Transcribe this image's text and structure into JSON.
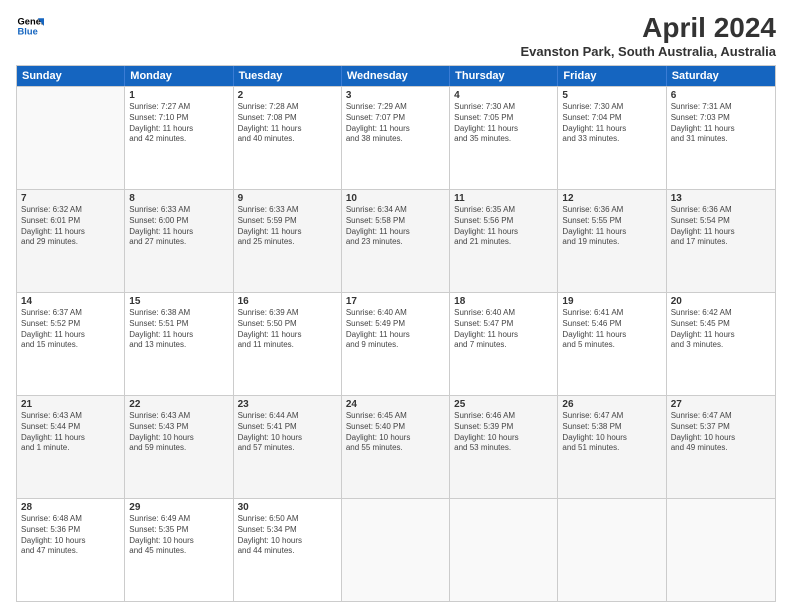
{
  "logo": {
    "line1": "General",
    "line2": "Blue"
  },
  "title": "April 2024",
  "subtitle": "Evanston Park, South Australia, Australia",
  "weekdays": [
    "Sunday",
    "Monday",
    "Tuesday",
    "Wednesday",
    "Thursday",
    "Friday",
    "Saturday"
  ],
  "rows": [
    [
      {
        "day": "",
        "info": ""
      },
      {
        "day": "1",
        "info": "Sunrise: 7:27 AM\nSunset: 7:10 PM\nDaylight: 11 hours\nand 42 minutes."
      },
      {
        "day": "2",
        "info": "Sunrise: 7:28 AM\nSunset: 7:08 PM\nDaylight: 11 hours\nand 40 minutes."
      },
      {
        "day": "3",
        "info": "Sunrise: 7:29 AM\nSunset: 7:07 PM\nDaylight: 11 hours\nand 38 minutes."
      },
      {
        "day": "4",
        "info": "Sunrise: 7:30 AM\nSunset: 7:05 PM\nDaylight: 11 hours\nand 35 minutes."
      },
      {
        "day": "5",
        "info": "Sunrise: 7:30 AM\nSunset: 7:04 PM\nDaylight: 11 hours\nand 33 minutes."
      },
      {
        "day": "6",
        "info": "Sunrise: 7:31 AM\nSunset: 7:03 PM\nDaylight: 11 hours\nand 31 minutes."
      }
    ],
    [
      {
        "day": "7",
        "info": "Sunrise: 6:32 AM\nSunset: 6:01 PM\nDaylight: 11 hours\nand 29 minutes."
      },
      {
        "day": "8",
        "info": "Sunrise: 6:33 AM\nSunset: 6:00 PM\nDaylight: 11 hours\nand 27 minutes."
      },
      {
        "day": "9",
        "info": "Sunrise: 6:33 AM\nSunset: 5:59 PM\nDaylight: 11 hours\nand 25 minutes."
      },
      {
        "day": "10",
        "info": "Sunrise: 6:34 AM\nSunset: 5:58 PM\nDaylight: 11 hours\nand 23 minutes."
      },
      {
        "day": "11",
        "info": "Sunrise: 6:35 AM\nSunset: 5:56 PM\nDaylight: 11 hours\nand 21 minutes."
      },
      {
        "day": "12",
        "info": "Sunrise: 6:36 AM\nSunset: 5:55 PM\nDaylight: 11 hours\nand 19 minutes."
      },
      {
        "day": "13",
        "info": "Sunrise: 6:36 AM\nSunset: 5:54 PM\nDaylight: 11 hours\nand 17 minutes."
      }
    ],
    [
      {
        "day": "14",
        "info": "Sunrise: 6:37 AM\nSunset: 5:52 PM\nDaylight: 11 hours\nand 15 minutes."
      },
      {
        "day": "15",
        "info": "Sunrise: 6:38 AM\nSunset: 5:51 PM\nDaylight: 11 hours\nand 13 minutes."
      },
      {
        "day": "16",
        "info": "Sunrise: 6:39 AM\nSunset: 5:50 PM\nDaylight: 11 hours\nand 11 minutes."
      },
      {
        "day": "17",
        "info": "Sunrise: 6:40 AM\nSunset: 5:49 PM\nDaylight: 11 hours\nand 9 minutes."
      },
      {
        "day": "18",
        "info": "Sunrise: 6:40 AM\nSunset: 5:47 PM\nDaylight: 11 hours\nand 7 minutes."
      },
      {
        "day": "19",
        "info": "Sunrise: 6:41 AM\nSunset: 5:46 PM\nDaylight: 11 hours\nand 5 minutes."
      },
      {
        "day": "20",
        "info": "Sunrise: 6:42 AM\nSunset: 5:45 PM\nDaylight: 11 hours\nand 3 minutes."
      }
    ],
    [
      {
        "day": "21",
        "info": "Sunrise: 6:43 AM\nSunset: 5:44 PM\nDaylight: 11 hours\nand 1 minute."
      },
      {
        "day": "22",
        "info": "Sunrise: 6:43 AM\nSunset: 5:43 PM\nDaylight: 10 hours\nand 59 minutes."
      },
      {
        "day": "23",
        "info": "Sunrise: 6:44 AM\nSunset: 5:41 PM\nDaylight: 10 hours\nand 57 minutes."
      },
      {
        "day": "24",
        "info": "Sunrise: 6:45 AM\nSunset: 5:40 PM\nDaylight: 10 hours\nand 55 minutes."
      },
      {
        "day": "25",
        "info": "Sunrise: 6:46 AM\nSunset: 5:39 PM\nDaylight: 10 hours\nand 53 minutes."
      },
      {
        "day": "26",
        "info": "Sunrise: 6:47 AM\nSunset: 5:38 PM\nDaylight: 10 hours\nand 51 minutes."
      },
      {
        "day": "27",
        "info": "Sunrise: 6:47 AM\nSunset: 5:37 PM\nDaylight: 10 hours\nand 49 minutes."
      }
    ],
    [
      {
        "day": "28",
        "info": "Sunrise: 6:48 AM\nSunset: 5:36 PM\nDaylight: 10 hours\nand 47 minutes."
      },
      {
        "day": "29",
        "info": "Sunrise: 6:49 AM\nSunset: 5:35 PM\nDaylight: 10 hours\nand 45 minutes."
      },
      {
        "day": "30",
        "info": "Sunrise: 6:50 AM\nSunset: 5:34 PM\nDaylight: 10 hours\nand 44 minutes."
      },
      {
        "day": "",
        "info": ""
      },
      {
        "day": "",
        "info": ""
      },
      {
        "day": "",
        "info": ""
      },
      {
        "day": "",
        "info": ""
      }
    ]
  ]
}
